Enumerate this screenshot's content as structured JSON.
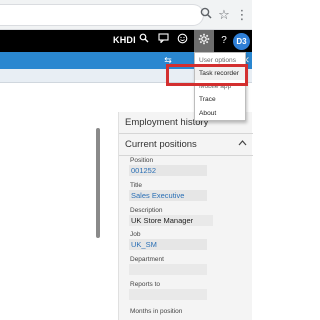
{
  "browser": {
    "icons": [
      "search-icon",
      "star-icon",
      "more-icon"
    ]
  },
  "navbar": {
    "company": "KHDI",
    "avatar_initials": "D3",
    "icons": [
      "search-icon",
      "chat-icon",
      "smiley-icon",
      "gear-icon",
      "help-icon"
    ]
  },
  "menu": {
    "items": [
      {
        "label": "User options"
      },
      {
        "label": "Task recorder"
      },
      {
        "label": "Mobile app"
      },
      {
        "label": "Trace"
      },
      {
        "label": "About"
      }
    ]
  },
  "factbox": {
    "employment_history": "Employment history",
    "current_positions": "Current positions",
    "fields": [
      {
        "label": "Position",
        "value": "001252",
        "link": true
      },
      {
        "label": "Title",
        "value": "Sales Executive",
        "link": true
      },
      {
        "label": "Description",
        "value": "UK Store Manager",
        "link": false
      },
      {
        "label": "Job",
        "value": "UK_SM",
        "link": true
      },
      {
        "label": "Department",
        "value": "",
        "link": false
      },
      {
        "label": "Reports to",
        "value": "",
        "link": false
      },
      {
        "label": "Months in position",
        "value": "",
        "link": false
      }
    ]
  },
  "colors": {
    "navbar": "#000000",
    "actionbar": "#2a87d0",
    "annotation": "#d32f2f",
    "link": "#2a6fb5"
  }
}
